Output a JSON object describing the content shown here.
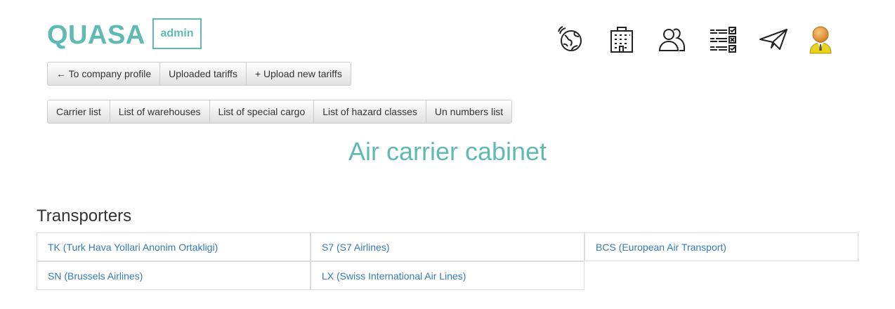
{
  "header": {
    "logo": "QUASA",
    "role_badge": "admin",
    "icons": [
      "globe-icon",
      "building-icon",
      "users-icon",
      "checklist-icon",
      "paper-plane-icon",
      "user-avatar-icon"
    ]
  },
  "nav_primary": {
    "to_company_profile": "← To company profile",
    "uploaded_tariffs": "Uploaded tariffs",
    "upload_new_tariffs": "+ Upload new tariffs"
  },
  "nav_secondary": {
    "carrier_list": "Carrier list",
    "warehouses": "List of warehouses",
    "special_cargo": "List of special cargo",
    "hazard_classes": "List of hazard classes",
    "un_numbers": "Un numbers list"
  },
  "page_title": "Air carrier cabinet",
  "transporters": {
    "title": "Transporters",
    "items": [
      {
        "label": "TK (Turk Hava Yollari Anonim Ortakligi)"
      },
      {
        "label": "S7 (S7 Airlines)"
      },
      {
        "label": "BCS (European Air Transport)"
      },
      {
        "label": "SN (Brussels Airlines)"
      },
      {
        "label": "LX (Swiss International Air Lines)"
      }
    ]
  },
  "colors": {
    "accent": "#5fbab3",
    "link": "#337ab7"
  }
}
